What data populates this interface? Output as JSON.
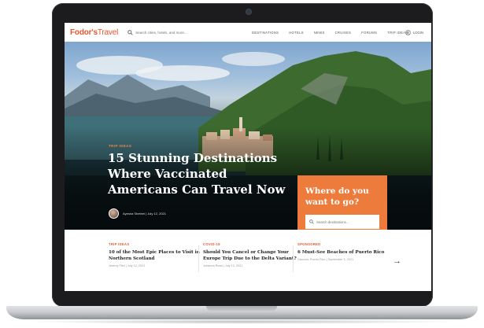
{
  "header": {
    "logo_brand": "Fodor's",
    "logo_suffix": "Travel",
    "search_placeholder": "Search cities, hotels, and more...",
    "nav": [
      "DESTINATIONS",
      "HOTELS",
      "NEWS",
      "CRUISES",
      "FORUMS",
      "TRIP IDEAS"
    ],
    "login_label": "LOGIN"
  },
  "hero": {
    "kicker": "TRIP IDEAS",
    "title": "15 Stunning Destinations Where Vaccinated Americans Can Travel Now",
    "byline": "Ayesha Sheteel | July 12, 2021"
  },
  "where_box": {
    "title": "Where do you want to go?",
    "search_placeholder": "Search destinations...",
    "prev_arrow": "←",
    "next_arrow": "→",
    "slide_count": 3,
    "active_slide": 1
  },
  "cards": [
    {
      "category": "TRIP IDEAS",
      "title": "10 of the Most Epic Places to Visit in Northern Scotland",
      "meta": "Jeremy Flint | July 12, 2021"
    },
    {
      "category": "COVID-19",
      "title": "Should You Cancel or Change Your Europe Trip Due to the Delta Variant?",
      "meta": "Johanna Read | July 12, 2021"
    },
    {
      "category": "SPONSORED",
      "title": "6 Must-See Beaches of Puerto Rico",
      "meta": "Discover Puerto Rico | September 3, 2021"
    }
  ],
  "strip_next_arrow": "→",
  "colors": {
    "brand": "#e4572e",
    "accent_box": "#ed7b3b",
    "bezel": "#1c1c1e"
  }
}
